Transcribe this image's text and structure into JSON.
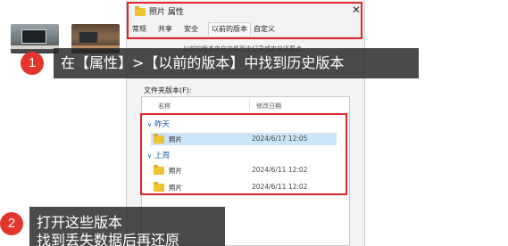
{
  "dialog": {
    "title": "照片 属性",
    "close_icon": "close-icon",
    "tabs": [
      {
        "label": "常规"
      },
      {
        "label": "共享"
      },
      {
        "label": "安全"
      },
      {
        "label": "以前的版本"
      },
      {
        "label": "自定义"
      }
    ],
    "description": "以前的版本来自文件历史记录或来自还原点。",
    "versions_label": "文件夹版本(F):",
    "columns": {
      "name": "名称",
      "date": "修改日期"
    },
    "groups": [
      {
        "label": "昨天",
        "rows": [
          {
            "name": "照片",
            "date": "2024/6/17 12:05"
          }
        ]
      },
      {
        "label": "上周",
        "rows": [
          {
            "name": "照片",
            "date": "2024/6/11 12:02"
          },
          {
            "name": "照片",
            "date": "2024/6/11 12:02"
          }
        ]
      }
    ]
  },
  "callouts": [
    {
      "number": "1",
      "text": "在【属性】>【以前的版本】中找到历史版本"
    },
    {
      "number": "2",
      "line1": "打开这些版本",
      "line2": "找到丢失数据后再还原"
    }
  ],
  "colors": {
    "highlight": "#e0242b",
    "badge": "#e3352b",
    "group_text": "#1a5aa8",
    "selected_row": "#cce4f7"
  }
}
